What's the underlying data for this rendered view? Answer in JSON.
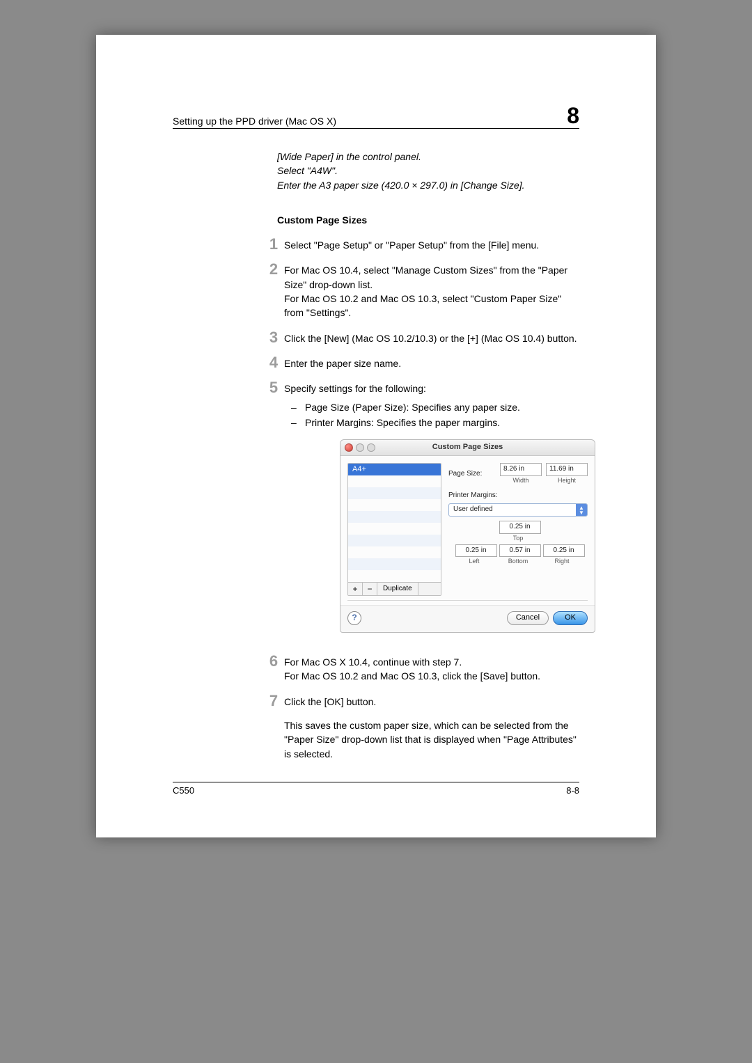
{
  "header": {
    "left": "Setting up the PPD driver (Mac OS X)",
    "chapter": "8"
  },
  "note": {
    "line1": "[Wide Paper] in the control panel.",
    "line2": "Select \"A4W\".",
    "line3": "Enter the A3 paper size (420.0 × 297.0) in [Change Size]."
  },
  "section_title": "Custom Page Sizes",
  "steps": {
    "s1": {
      "num": "1",
      "text": "Select \"Page Setup\" or \"Paper Setup\" from the [File] menu."
    },
    "s2": {
      "num": "2",
      "p1": "For Mac OS 10.4, select \"Manage Custom Sizes\" from the \"Paper Size\" drop-down list.",
      "p2": "For Mac OS 10.2 and Mac OS 10.3, select \"Custom Paper Size\" from \"Settings\"."
    },
    "s3": {
      "num": "3",
      "text": "Click the [New] (Mac OS 10.2/10.3) or the [+] (Mac OS 10.4) button."
    },
    "s4": {
      "num": "4",
      "text": "Enter the paper size name."
    },
    "s5": {
      "num": "5",
      "lead": "Specify settings for the following:",
      "b1": "Page Size (Paper Size): Specifies any paper size.",
      "b2": "Printer Margins: Specifies the paper margins."
    },
    "s6": {
      "num": "6",
      "l1": "For Mac OS X 10.4, continue with step 7.",
      "l2": "For Mac OS 10.2 and Mac OS 10.3, click the [Save] button."
    },
    "s7": {
      "num": "7",
      "text": "Click the [OK] button.",
      "after": "This saves the custom paper size, which can be selected from the \"Paper Size\" drop-down list that is displayed when \"Page Attributes\" is selected."
    }
  },
  "dialog": {
    "title": "Custom Page Sizes",
    "list_item": "A4+",
    "plus": "+",
    "minus": "−",
    "duplicate": "Duplicate",
    "page_size_label": "Page Size:",
    "width_val": "8.26 in",
    "width_lbl": "Width",
    "height_val": "11.69 in",
    "height_lbl": "Height",
    "margins_label": "Printer Margins:",
    "dropdown_value": "User defined",
    "top_val": "0.25 in",
    "top_lbl": "Top",
    "left_val": "0.25 in",
    "left_lbl": "Left",
    "right_val": "0.25 in",
    "right_lbl": "Right",
    "bottom_val": "0.57 in",
    "bottom_lbl": "Bottom",
    "help": "?",
    "cancel": "Cancel",
    "ok": "OK"
  },
  "footer": {
    "left": "C550",
    "right": "8-8"
  }
}
